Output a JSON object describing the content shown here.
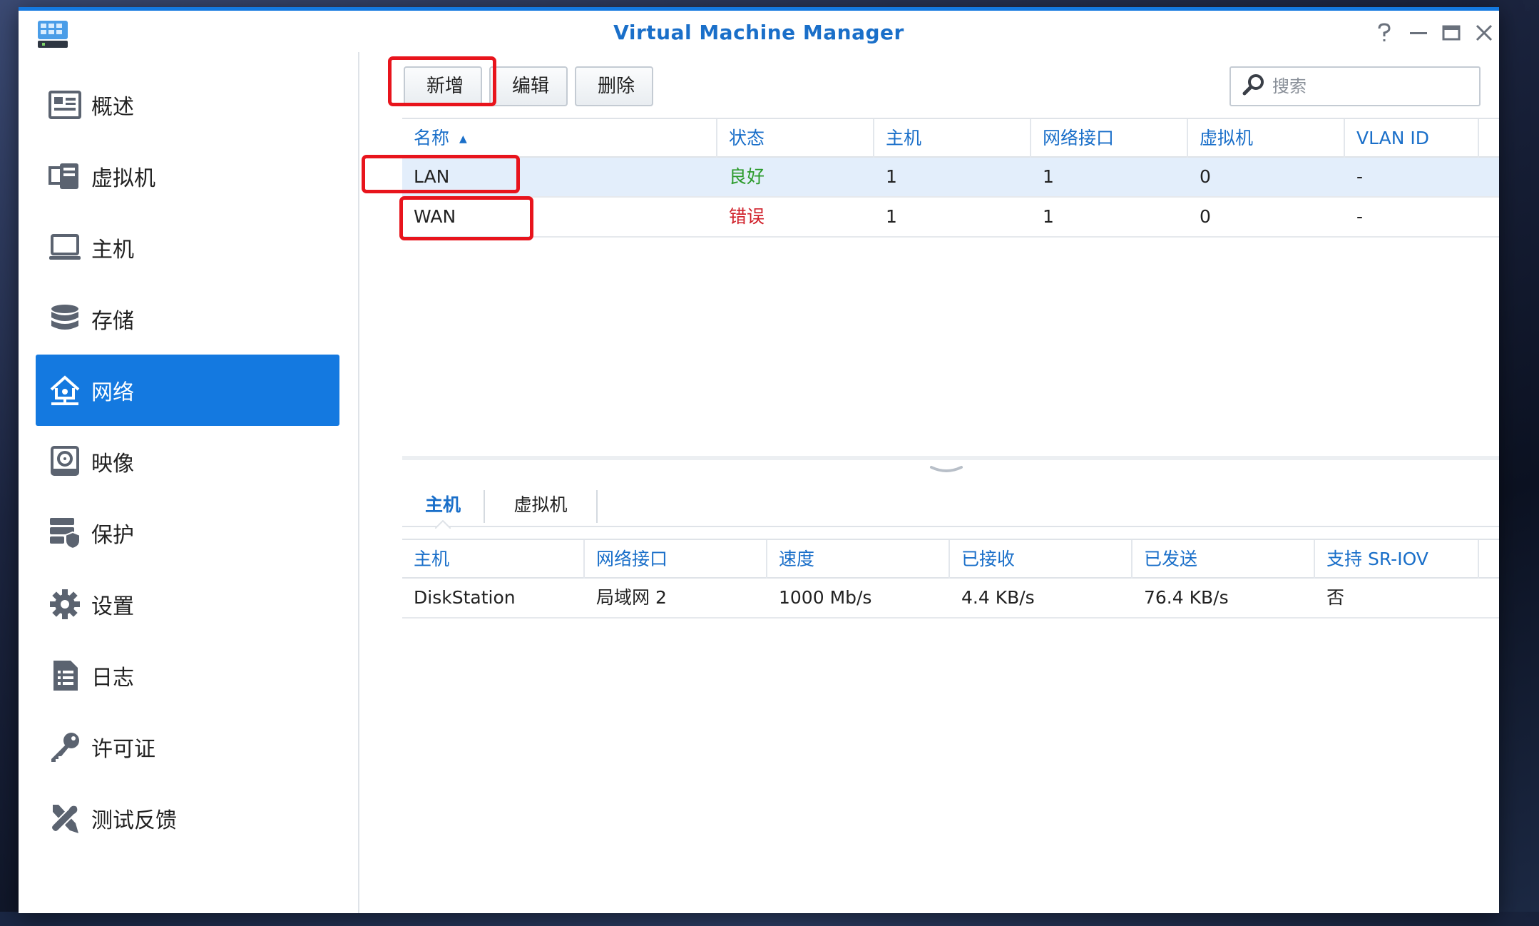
{
  "window": {
    "title": "Virtual Machine Manager"
  },
  "sidebar": {
    "items": [
      {
        "label": "概述",
        "icon": "overview-icon"
      },
      {
        "label": "虚拟机",
        "icon": "virtual-machine-icon"
      },
      {
        "label": "主机",
        "icon": "host-icon"
      },
      {
        "label": "存储",
        "icon": "storage-icon"
      },
      {
        "label": "网络",
        "icon": "network-icon",
        "active": true
      },
      {
        "label": "映像",
        "icon": "image-icon"
      },
      {
        "label": "保护",
        "icon": "protection-icon"
      },
      {
        "label": "设置",
        "icon": "settings-icon"
      },
      {
        "label": "日志",
        "icon": "log-icon"
      },
      {
        "label": "许可证",
        "icon": "license-icon"
      },
      {
        "label": "测试反馈",
        "icon": "feedback-icon"
      }
    ]
  },
  "toolbar": {
    "add": "新增",
    "edit": "编辑",
    "delete": "删除"
  },
  "search": {
    "placeholder": "搜索"
  },
  "network_table": {
    "columns": [
      "名称",
      "状态",
      "主机",
      "网络接口",
      "虚拟机",
      "VLAN ID"
    ],
    "rows": [
      {
        "name": "LAN",
        "status": "良好",
        "hosts": "1",
        "interfaces": "1",
        "vms": "0",
        "vlan": "-"
      },
      {
        "name": "WAN",
        "status": "错误",
        "hosts": "1",
        "interfaces": "1",
        "vms": "0",
        "vlan": "-"
      }
    ]
  },
  "colors": {
    "accent": "#1479e0",
    "good": "#2a9a2a",
    "error": "#d0202a",
    "highlight": "#e8141c"
  },
  "detail_tabs": [
    "主机",
    "虚拟机"
  ],
  "host_table": {
    "columns": [
      "主机",
      "网络接口",
      "速度",
      "已接收",
      "已发送",
      "支持 SR-IOV"
    ],
    "rows": [
      {
        "host": "DiskStation",
        "interface": "局域网 2",
        "speed": "1000 Mb/s",
        "received": "4.4 KB/s",
        "sent": "76.4 KB/s",
        "sriov": "否"
      }
    ]
  }
}
